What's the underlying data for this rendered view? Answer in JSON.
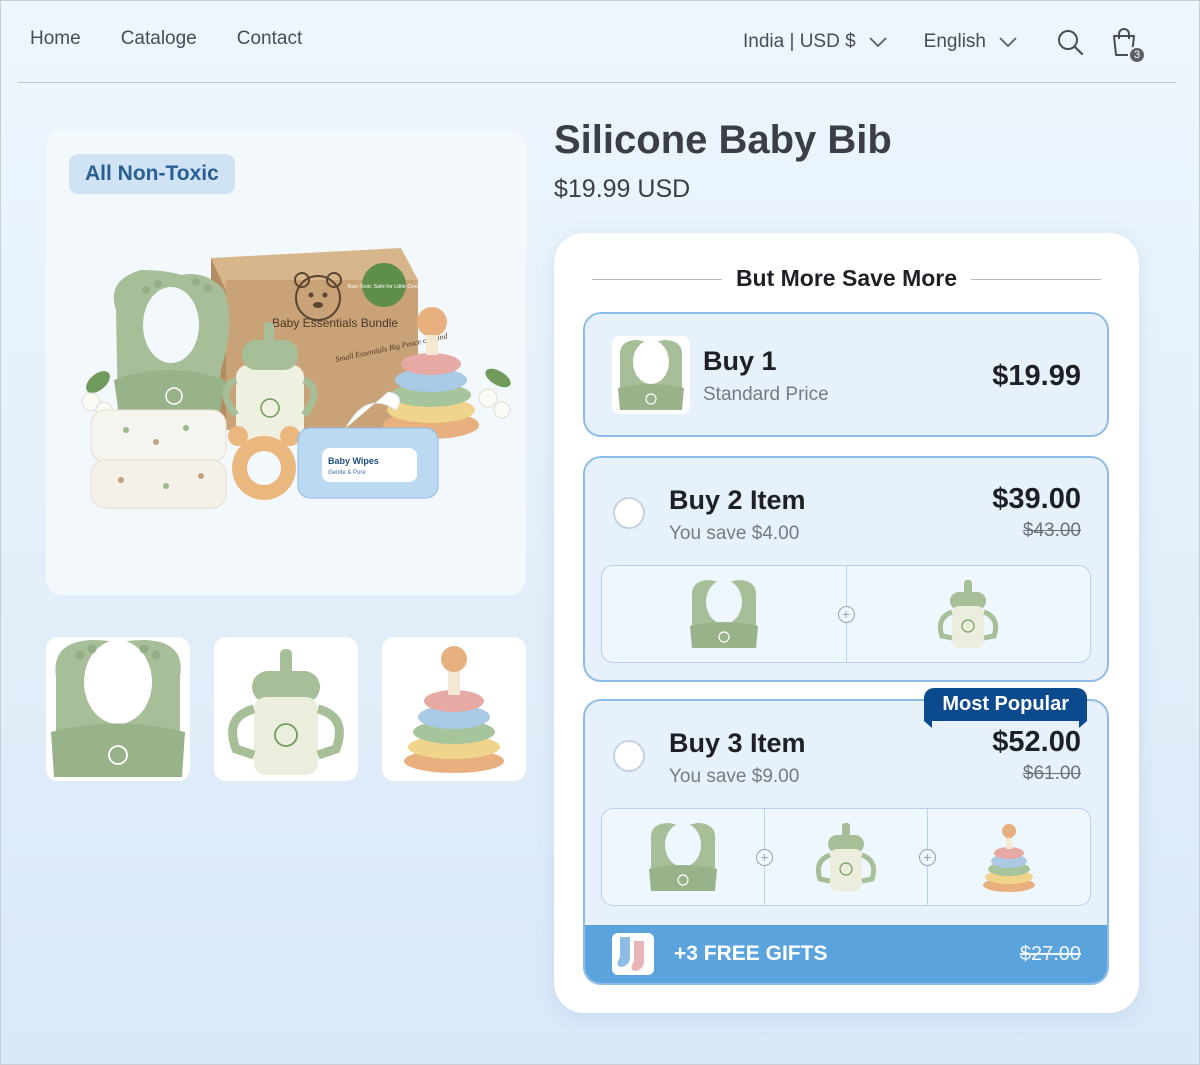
{
  "nav": {
    "items": [
      "Home",
      "Cataloge",
      "Contact"
    ]
  },
  "header": {
    "region": "India | USD $",
    "language": "English",
    "cart_count": "3",
    "icons": [
      "chevron-down-icon",
      "search-icon",
      "cart-icon"
    ]
  },
  "gallery": {
    "badge": "All Non-Toxic",
    "box_title": "Baby Essentials Bundle",
    "box_tagline": "Small Essentials Big Peace of Mind",
    "box_seal": "Non-Toxic Safe for Little Ones",
    "wipes_label": "Baby Wipes",
    "wipes_sub": "Gentle & Pure"
  },
  "product": {
    "title": "Silicone Baby Bib",
    "price": "$19.99 USD"
  },
  "bundles": {
    "heading": "But More Save More",
    "tiers": [
      {
        "title": "Buy 1",
        "subtitle": "Standard Price",
        "price": "$19.99"
      },
      {
        "title": "Buy 2 Item",
        "subtitle": "You save $4.00",
        "price": "$39.00",
        "old_price": "$43.00"
      },
      {
        "title": "Buy 3 Item",
        "subtitle": "You save $9.00",
        "price": "$52.00",
        "old_price": "$61.00",
        "badge": "Most Popular"
      }
    ],
    "gifts": {
      "label": "+3 FREE GIFTS",
      "old_price": "$27.00"
    }
  },
  "colors": {
    "accent": "#5ba3dc",
    "badge_dark": "#0b4a8d",
    "sage": "#a7bf98",
    "tier_border": "#8fbce6"
  }
}
